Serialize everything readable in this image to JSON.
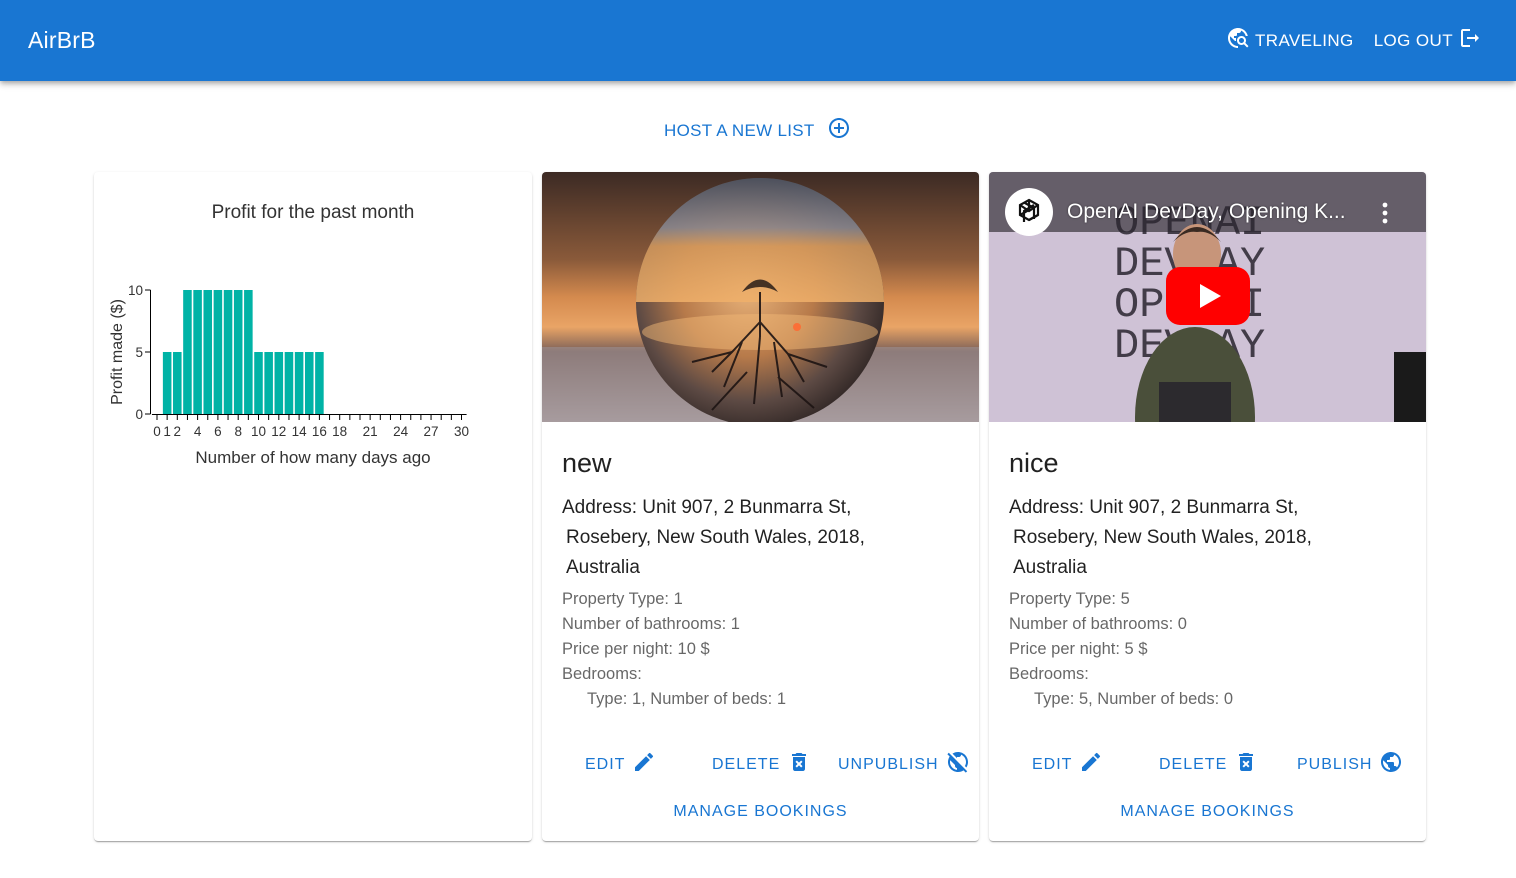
{
  "app": {
    "brand": "AirBrB",
    "nav": {
      "traveling_label": "TRAVELING",
      "logout_label": "LOG OUT"
    },
    "host_label": "HOST A NEW LIST"
  },
  "profit_chart": {
    "title": "Profit for the past month",
    "xlabel": "Number of how many days ago",
    "ylabel": "Profit made ($)"
  },
  "chart_data": {
    "type": "bar",
    "title": "Profit for the past month",
    "xlabel": "Number of how many days ago",
    "ylabel": "Profit made ($)",
    "x": [
      0,
      1,
      2,
      3,
      4,
      5,
      6,
      7,
      8,
      9,
      10,
      11,
      12,
      13,
      14,
      15,
      16,
      17,
      18,
      19,
      20,
      21,
      22,
      23,
      24,
      25,
      26,
      27,
      28,
      29,
      30
    ],
    "values": [
      0,
      5,
      5,
      10,
      10,
      10,
      10,
      10,
      10,
      10,
      5,
      5,
      5,
      5,
      5,
      5,
      5,
      0,
      0,
      0,
      0,
      0,
      0,
      0,
      0,
      0,
      0,
      0,
      0,
      0,
      0
    ],
    "xticks": [
      "0",
      "1",
      "2",
      "4",
      "6",
      "8",
      "10",
      "12",
      "14",
      "16",
      "18",
      "21",
      "24",
      "27",
      "30"
    ],
    "yticks": [
      "0",
      "5",
      "10"
    ],
    "ylim": [
      0,
      10
    ],
    "color": "#00b3a6",
    "grid": false
  },
  "listings": [
    {
      "title": "new",
      "address_line1": "Address: Unit 907, 2 Bunmarra St,",
      "address_line2": "Rosebery,  New South Wales,  2018,",
      "address_line3": "Australia",
      "property_type": "Property Type: 1",
      "bathrooms": "Number of bathrooms: 1",
      "price": "Price per night: 10 $",
      "bedrooms_label": "Bedrooms:",
      "bedroom_detail": "Type: 1, Number of beds: 1",
      "edit_label": "EDIT",
      "delete_label": "DELETE",
      "publish_label": "UNPUBLISH",
      "manage_label": "MANAGE BOOKINGS"
    },
    {
      "title": "nice",
      "video_title": "OpenAI DevDay, Opening K...",
      "video_backdrop_text": [
        "OPENAI",
        "DEVDAY",
        "OPENAI",
        "DEVDAY"
      ],
      "address_line1": "Address: Unit 907, 2 Bunmarra St,",
      "address_line2": "Rosebery,  New South Wales,  2018,",
      "address_line3": "Australia",
      "property_type": "Property Type: 5",
      "bathrooms": "Number of bathrooms: 0",
      "price": "Price per night: 5 $",
      "bedrooms_label": "Bedrooms:",
      "bedroom_detail": "Type: 5, Number of beds: 0",
      "edit_label": "EDIT",
      "delete_label": "DELETE",
      "publish_label": "PUBLISH",
      "manage_label": "MANAGE BOOKINGS"
    }
  ],
  "colors": {
    "primary": "#1976d2",
    "bar": "#00b3a6",
    "yt_red": "#ff0000"
  }
}
